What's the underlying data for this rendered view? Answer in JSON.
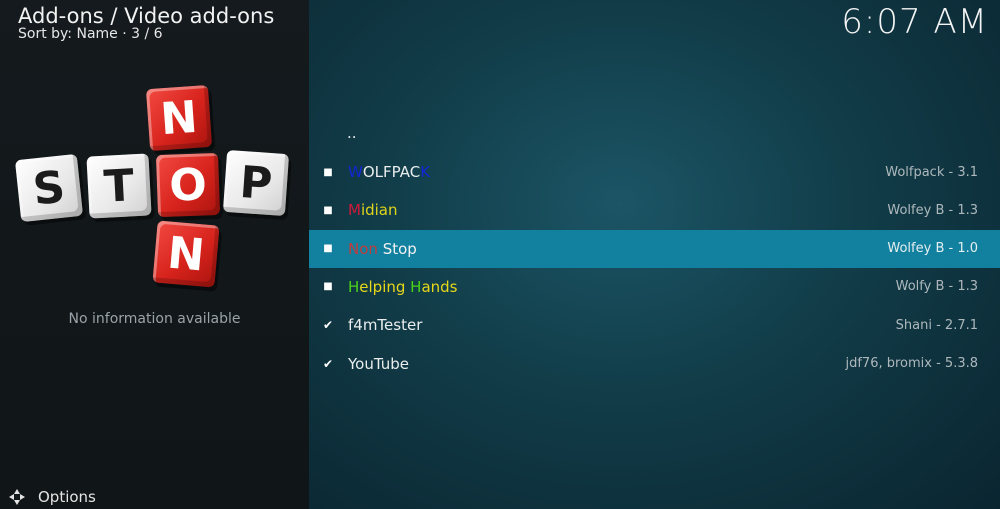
{
  "header": {
    "breadcrumb": "Add-ons / Video add-ons",
    "sort_line": "Sort by: Name  ·  3 / 6",
    "clock": "6:07 AM"
  },
  "info_panel": {
    "logo_letters_row": [
      "S",
      "T",
      "O",
      "P"
    ],
    "logo_letters_column": [
      "N",
      "O",
      "N"
    ],
    "no_info": "No information available"
  },
  "list": {
    "parent_item": "..",
    "items": [
      {
        "name_parts": [
          {
            "t": "W",
            "c": "#1226d8"
          },
          {
            "t": "OLFPAC",
            "c": "#e9edee"
          },
          {
            "t": "K",
            "c": "#1226d8"
          }
        ],
        "version": "Wolfpack - 3.1",
        "status": "square"
      },
      {
        "name_parts": [
          {
            "t": "M",
            "c": "#d0183a"
          },
          {
            "t": "idian",
            "c": "#e0d51a"
          }
        ],
        "version": "Wolfey B - 1.3",
        "status": "square"
      },
      {
        "name_parts": [
          {
            "t": "Non ",
            "c": "#c23b3b"
          },
          {
            "t": "Stop",
            "c": "#f2f2f2"
          }
        ],
        "version": "Wolfey B - 1.0",
        "status": "square",
        "selected": true
      },
      {
        "name_parts": [
          {
            "t": "H",
            "c": "#4bd317"
          },
          {
            "t": "elping ",
            "c": "#e8d719"
          },
          {
            "t": "H",
            "c": "#4bd317"
          },
          {
            "t": "ands",
            "c": "#e8d719"
          }
        ],
        "version": "Wolfy B - 1.3",
        "status": "square"
      },
      {
        "name_parts": [
          {
            "t": "f4mTester",
            "c": "#e9edee"
          }
        ],
        "version": "Shani - 2.7.1",
        "status": "check"
      },
      {
        "name_parts": [
          {
            "t": "YouTube",
            "c": "#e9edee"
          }
        ],
        "version": "jdf76, bromix - 5.3.8",
        "status": "check"
      }
    ]
  },
  "footer": {
    "options_label": "Options",
    "options_icon": "options-gear-icon"
  },
  "colors": {
    "selected_row": "#12819f",
    "left_panel": "#141a1d",
    "right_panel": "#113c48"
  }
}
